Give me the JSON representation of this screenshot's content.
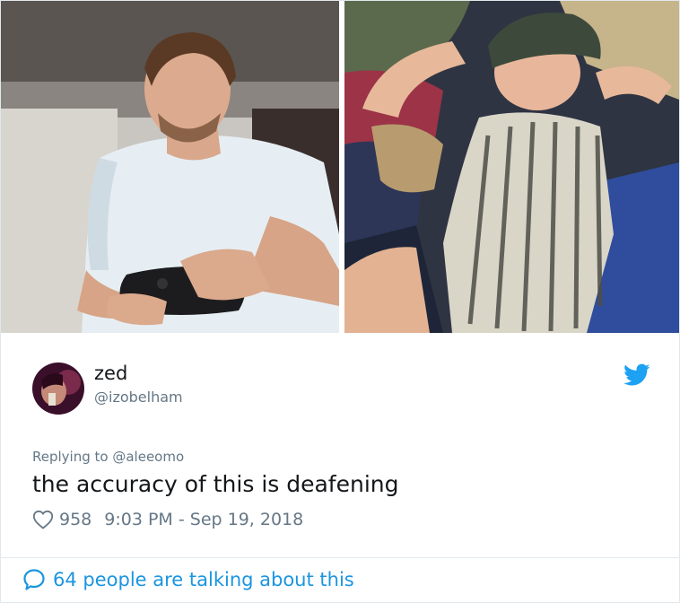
{
  "photos": {
    "left": {
      "icon": "photo-man-gaming"
    },
    "right": {
      "icon": "photo-woman-napping"
    }
  },
  "tweet": {
    "display_name": "zed",
    "handle": "@izobelham",
    "reply_prefix": "Replying to",
    "reply_mention": "@aleeomo",
    "text": "the accuracy of this is deafening",
    "likes": "958",
    "timestamp": "9:03 PM - Sep 19, 2018"
  },
  "footer": {
    "label": "64 people are talking about this"
  },
  "colors": {
    "twitter_blue": "#1b95e0",
    "muted_text": "#657786",
    "primary_text": "#14171a",
    "border": "#e1e8ed"
  }
}
